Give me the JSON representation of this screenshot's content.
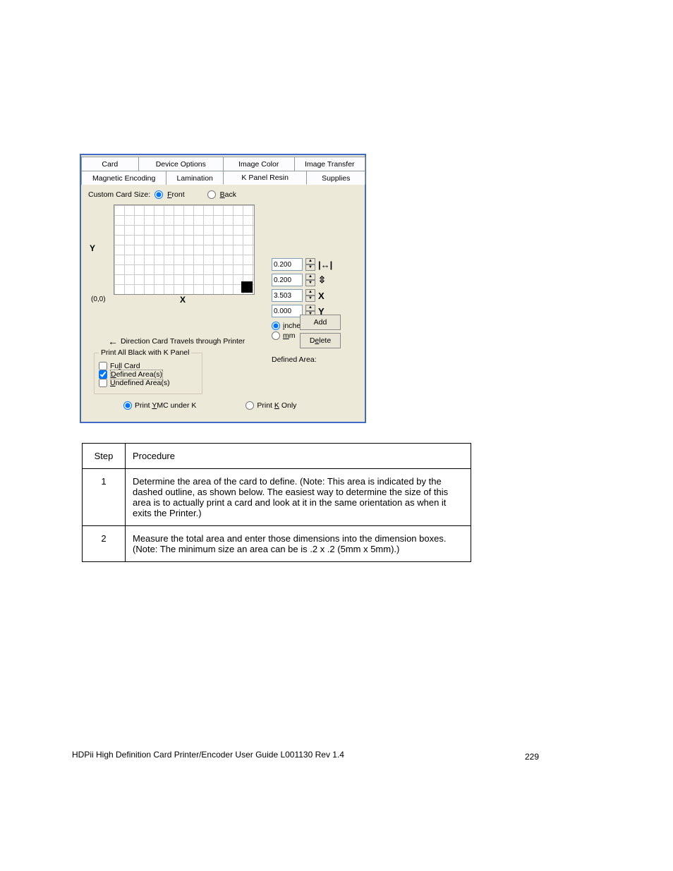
{
  "tabs_row1": [
    "Card",
    "Device Options",
    "Image Color",
    "Image Transfer"
  ],
  "tabs_row2": [
    "Magnetic Encoding",
    "Lamination",
    "K Panel Resin",
    "Supplies"
  ],
  "custom_card_label": "Custom Card Size:",
  "front_label": "Front",
  "back_label": "Back",
  "y_axis": "Y",
  "x_axis": "X",
  "origin": "(0,0)",
  "spinners": [
    {
      "value": "0.200",
      "icon": "↔"
    },
    {
      "value": "0.200",
      "icon": "↕"
    },
    {
      "value": "3.503",
      "icon": "X"
    },
    {
      "value": "0.000",
      "icon": "Y"
    }
  ],
  "units_inches": "inches",
  "units_mm": "mm",
  "defined_area_label": "Defined Area:",
  "add_btn": "Add",
  "delete_btn": "Delete",
  "direction_text": "Direction Card Travels through Printer",
  "fieldset_legend": "Print All Black with K Panel",
  "full_card": "Full Card",
  "defined_areas": "Defined Area(s)",
  "undefined_areas": "Undefined Area(s)",
  "print_ymc": "Print YMC under K",
  "print_k": "Print K Only",
  "table": {
    "header_step": "Step",
    "header_proc": "Procedure",
    "rows": [
      {
        "num": "1",
        "text_a": "Determine the area of the card to define. (",
        "text_b": "This area is indicated by the dashed outline, as shown below. The easiest way to determine the size of this area is to actually print a card and look at it in the same orientation as when it exits the Printer.)",
        "note": "Note:"
      },
      {
        "num": "2",
        "text_a": "Measure the total area and enter those dimensions into the dimension boxes. (",
        "text_b": "The minimum size an area can be is .2 x .2 (5mm x 5mm).)",
        "note": "Note:"
      }
    ]
  },
  "footer_text": "HDPii High Definition Card Printer/Encoder User Guide    L001130 Rev 1.4",
  "page_num": "229"
}
